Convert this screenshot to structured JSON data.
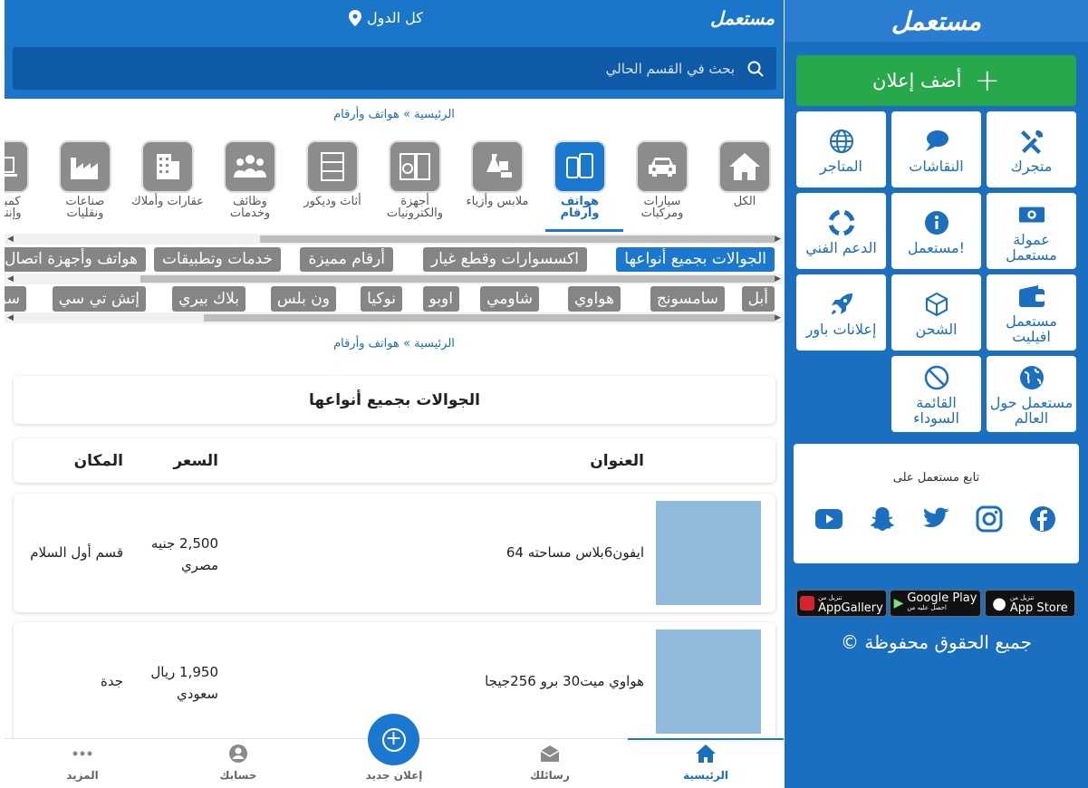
{
  "sidebar": {
    "logo": "مستعمل",
    "add_ad": "أضف إعلان",
    "tiles": [
      {
        "label": "متجرك",
        "icon": "tools-icon"
      },
      {
        "label": "النقاشات",
        "icon": "chat-icon"
      },
      {
        "label": "المتاجر",
        "icon": "globe-icon"
      },
      {
        "label": "عمولة مستعمل",
        "icon": "money-icon"
      },
      {
        "label": "مستعمل!",
        "icon": "info-icon"
      },
      {
        "label": "الدعم الفني",
        "icon": "lifebuoy-icon"
      },
      {
        "label": "مستعمل افيليت",
        "icon": "wallet-icon"
      },
      {
        "label": "الشحن",
        "icon": "box-icon"
      },
      {
        "label": "إعلانات باور",
        "icon": "rocket-icon"
      },
      {
        "label": "مستعمل حول العالم",
        "icon": "world-icon"
      },
      {
        "label": "القائمة السوداء",
        "icon": "ban-icon"
      }
    ],
    "follow": "تابع مستعمل على",
    "stores": [
      {
        "label": "App Store",
        "sub": "تنزيل من"
      },
      {
        "label": "Google Play",
        "sub": "احصل عليه من"
      },
      {
        "label": "AppGallery",
        "sub": "تنزيل من"
      }
    ],
    "copyright": "جميع الحقوق محفوظة ©"
  },
  "header": {
    "logo": "مستعمل",
    "country": "كل الدول",
    "search_placeholder": "بحث في القسم الحالي"
  },
  "breadcrumb": {
    "home": "الرئيسية",
    "sep": "»",
    "current": "هواتف وأرقام"
  },
  "categories": [
    {
      "label": "الكل",
      "icon": "home-icon"
    },
    {
      "label": "سيارات ومركبات",
      "icon": "car-icon"
    },
    {
      "label": "هواتف وأرقام",
      "icon": "phones-icon",
      "selected": true
    },
    {
      "label": "ملابس وأزياء",
      "icon": "clothes-icon"
    },
    {
      "label": "أجهزة والكترونيات",
      "icon": "appliances-icon"
    },
    {
      "label": "أثاث وديكور",
      "icon": "furniture-icon"
    },
    {
      "label": "وظائف وخدمات",
      "icon": "people-icon"
    },
    {
      "label": "عقارات وأملاك",
      "icon": "building-icon"
    },
    {
      "label": "صناعات ونقليات",
      "icon": "factory-icon"
    },
    {
      "label": "كمبيوتر وإنترنت",
      "icon": "laptop-icon"
    }
  ],
  "subcategories": [
    {
      "label": "الجوالات بجميع أنواعها",
      "selected": true
    },
    {
      "label": "اكسسوارات وقطع غيار"
    },
    {
      "label": "أرقام مميزة"
    },
    {
      "label": "خدمات وتطبيقات"
    },
    {
      "label": "هواتف وأجهزة اتصال"
    }
  ],
  "brands": [
    "أبل",
    "سامسونج",
    "هواوي",
    "شاومي",
    "اوبو",
    "نوكيا",
    "ون بلس",
    "بلاك بيري",
    "إتش تي سي",
    "سوني"
  ],
  "section_title": "الجوالات بجميع أنواعها",
  "table_header": {
    "title": "العنوان",
    "price": "السعر",
    "location": "المكان"
  },
  "listings": [
    {
      "title": "ايفون6بلاس مساحته 64",
      "price": "2,500 جنيه",
      "price2": "مصري",
      "location": "قسم أول السلام"
    },
    {
      "title": "هواوي ميت30 برو 256جيجا",
      "price": "1,950 ريال",
      "price2": "سعودي",
      "location": "جدة"
    }
  ],
  "footer": [
    {
      "label": "الرئيسية",
      "icon": "home-icon"
    },
    {
      "label": "رسائلك",
      "icon": "envelope-icon"
    },
    {
      "label": "إعلان جديد",
      "icon": "plus-icon"
    },
    {
      "label": "حسابك",
      "icon": "user-icon"
    },
    {
      "label": "المزيد",
      "icon": "more-icon"
    }
  ],
  "colors": {
    "primary": "#1976c9",
    "sidebar": "#1b6fc1",
    "green": "#27a84a",
    "chip": "#858585"
  }
}
